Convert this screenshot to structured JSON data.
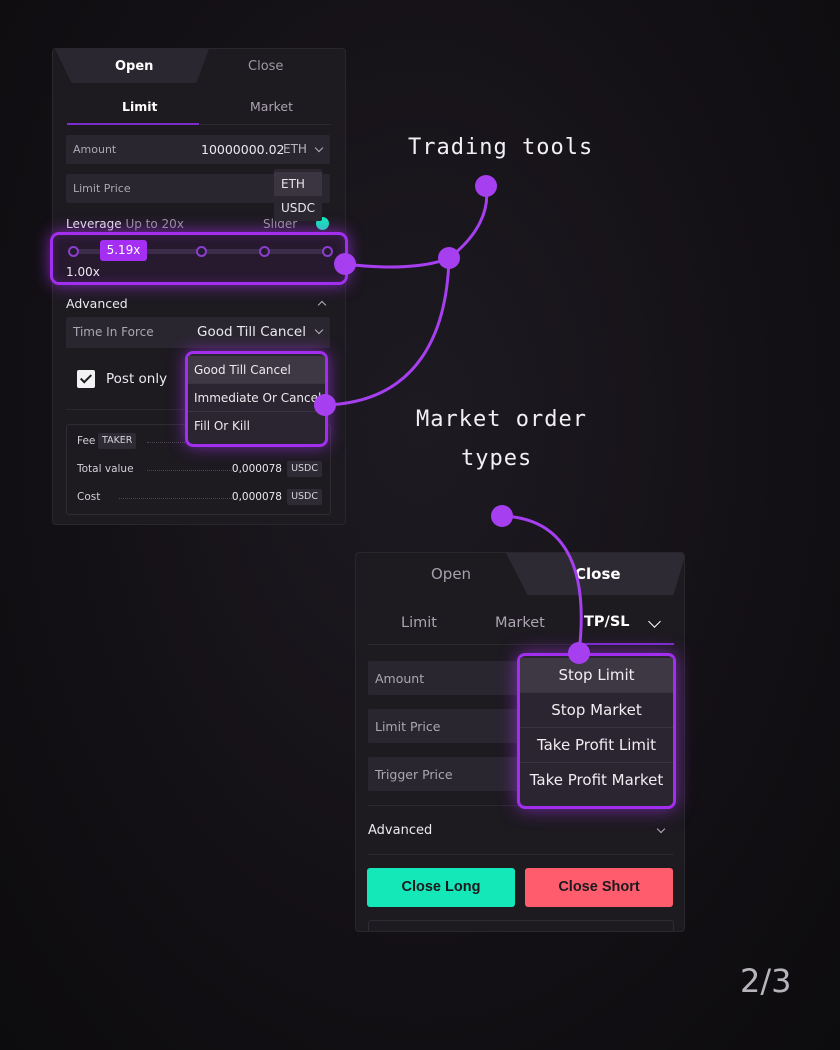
{
  "panel1": {
    "tabs": {
      "open": "Open",
      "close": "Close"
    },
    "subtabs": {
      "limit": "Limit",
      "market": "Market"
    },
    "amount": {
      "label": "Amount",
      "value": "10000000.02",
      "currency": "ETH"
    },
    "currency_options": [
      "ETH",
      "USDC"
    ],
    "limit_price": {
      "label": "Limit Price"
    },
    "leverage": {
      "label": "Leverage",
      "hint": "Up to 20x",
      "value": "5.19x",
      "current": "1.00x",
      "level_percent": 20,
      "slider_label": "Slider"
    },
    "advanced": {
      "label": "Advanced"
    },
    "time_in_force": {
      "label": "Time In Force",
      "value": "Good Till Cancel"
    },
    "tif_options": [
      "Good Till Cancel",
      "Immediate Or Cancel",
      "Fill Or Kill"
    ],
    "post_only": {
      "label": "Post only",
      "checked": true
    },
    "summary": {
      "fee_label": "Fee",
      "fee_badge": "TAKER",
      "total_label": "Total value",
      "total_value": "0,000078",
      "total_unit": "USDC",
      "cost_label": "Cost",
      "cost_value": "0,000078",
      "cost_unit": "USDC"
    }
  },
  "annotations": {
    "trading_tools": "Trading tools",
    "market_order_line1": "Market order",
    "market_order_line2": "types"
  },
  "panel2": {
    "tabs": {
      "open": "Open",
      "close": "Close"
    },
    "subtabs": {
      "limit": "Limit",
      "market": "Market",
      "tpsl": "TP/SL"
    },
    "fields": {
      "amount": "Amount",
      "limit_price": "Limit Price",
      "trigger_price": "Trigger Price"
    },
    "order_types": [
      "Stop Limit",
      "Stop Market",
      "Take Profit Limit",
      "Take Profit Market"
    ],
    "advanced": "Advanced",
    "close_long": "Close Long",
    "close_short": "Close Short"
  },
  "page_indicator": "2/3",
  "colors": {
    "accent": "#a22ef0",
    "long": "#14e8b8",
    "short": "#ff5c6e",
    "background": "#141116",
    "panel": "#1d1a20"
  }
}
